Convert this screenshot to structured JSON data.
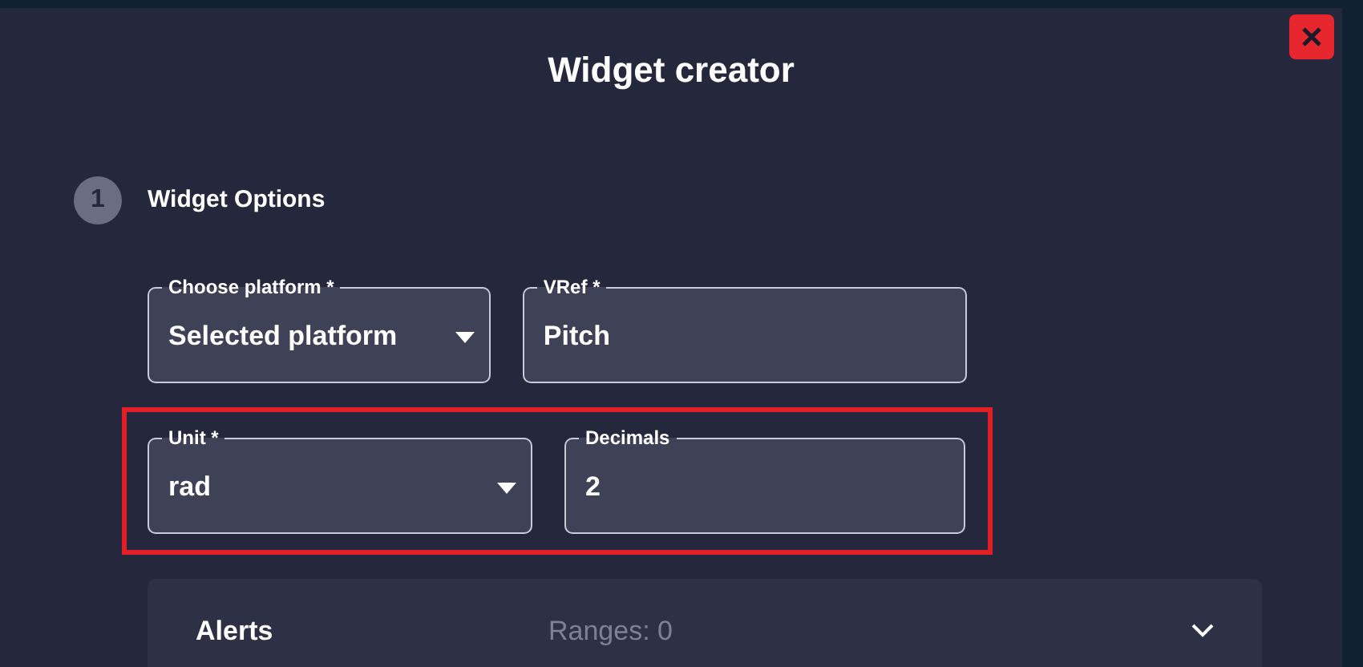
{
  "dialog": {
    "title": "Widget creator"
  },
  "step": {
    "number": "1",
    "title": "Widget Options"
  },
  "field_rows": [
    {
      "highlighted": false,
      "fields": [
        {
          "kind": "select",
          "label": "Choose platform *",
          "value": "Selected platform"
        },
        {
          "kind": "text",
          "label": "VRef *",
          "value": "Pitch"
        }
      ]
    },
    {
      "highlighted": true,
      "fields": [
        {
          "kind": "select",
          "label": "Unit *",
          "value": "rad"
        },
        {
          "kind": "text",
          "label": "Decimals",
          "value": "2"
        }
      ]
    }
  ],
  "alerts": {
    "title": "Alerts",
    "summary": "Ranges: 0",
    "expanded": false
  }
}
